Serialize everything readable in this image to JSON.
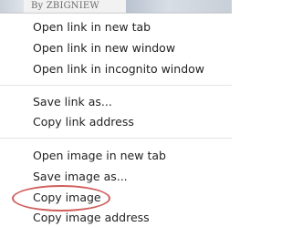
{
  "background": {
    "byline": "By ZBIGNIEW"
  },
  "context_menu": {
    "groups": [
      {
        "items": [
          {
            "label": "Open link in new tab"
          },
          {
            "label": "Open link in new window"
          },
          {
            "label": "Open link in incognito window"
          }
        ]
      },
      {
        "items": [
          {
            "label": "Save link as..."
          },
          {
            "label": "Copy link address"
          }
        ]
      },
      {
        "items": [
          {
            "label": "Open image in new tab"
          },
          {
            "label": "Save image as..."
          },
          {
            "label": "Copy image"
          },
          {
            "label": "Copy image address"
          }
        ]
      }
    ],
    "highlighted_item": "Copy image",
    "highlight_color": "#d0605f"
  }
}
